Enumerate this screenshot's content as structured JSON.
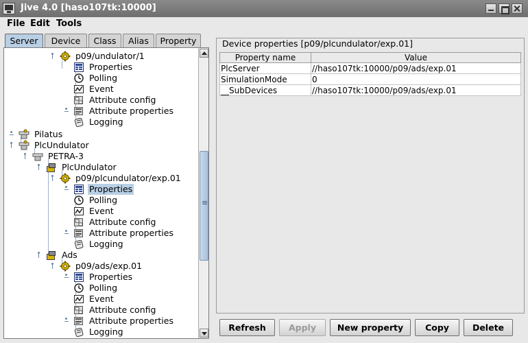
{
  "window": {
    "title": "Jive 4.0  [haso107tk:10000]"
  },
  "menu": [
    "File",
    "Edit",
    "Tools"
  ],
  "tabs": [
    "Server",
    "Device",
    "Class",
    "Alias",
    "Property"
  ],
  "tree": [
    {
      "label": "p09/undulator/1",
      "icon": "device-gear-icon"
    },
    {
      "label": "Properties",
      "icon": "properties-icon"
    },
    {
      "label": "Polling",
      "icon": "polling-clock-icon"
    },
    {
      "label": "Event",
      "icon": "event-icon"
    },
    {
      "label": "Attribute config",
      "icon": "attribute-config-icon"
    },
    {
      "label": "Attribute properties",
      "icon": "attribute-properties-icon"
    },
    {
      "label": "Logging",
      "icon": "logging-icon"
    },
    {
      "label": "Pilatus",
      "icon": "server-icon"
    },
    {
      "label": "PlcUndulator",
      "icon": "server-icon"
    },
    {
      "label": "PETRA-3",
      "icon": "server-instance-icon"
    },
    {
      "label": "PlcUndulator",
      "icon": "class-icon"
    },
    {
      "label": "p09/plcundulator/exp.01",
      "icon": "device-gear-icon"
    },
    {
      "label": "Properties",
      "icon": "properties-icon",
      "selected": true
    },
    {
      "label": "Polling",
      "icon": "polling-clock-icon"
    },
    {
      "label": "Event",
      "icon": "event-icon"
    },
    {
      "label": "Attribute config",
      "icon": "attribute-config-icon"
    },
    {
      "label": "Attribute properties",
      "icon": "attribute-properties-icon"
    },
    {
      "label": "Logging",
      "icon": "logging-icon"
    },
    {
      "label": "Ads",
      "icon": "class-icon"
    },
    {
      "label": "p09/ads/exp.01",
      "icon": "device-gear-icon"
    },
    {
      "label": "Properties",
      "icon": "properties-icon"
    },
    {
      "label": "Polling",
      "icon": "polling-clock-icon"
    },
    {
      "label": "Event",
      "icon": "event-icon"
    },
    {
      "label": "Attribute config",
      "icon": "attribute-config-icon"
    },
    {
      "label": "Attribute properties",
      "icon": "attribute-properties-icon"
    },
    {
      "label": "Logging",
      "icon": "logging-icon"
    }
  ],
  "panel": {
    "title": "Device properties [p09/plcundulator/exp.01]",
    "columns": [
      "Property name",
      "Value"
    ],
    "rows": [
      [
        "PlcServer",
        "//haso107tk:10000/p09/ads/exp.01"
      ],
      [
        "SimulationMode",
        "0"
      ],
      [
        "__SubDevices",
        "//haso107tk:10000/p09/ads/exp.01"
      ]
    ]
  },
  "buttons": {
    "refresh": "Refresh",
    "apply": "Apply",
    "new_property": "New property",
    "copy": "Copy",
    "delete": "Delete"
  }
}
